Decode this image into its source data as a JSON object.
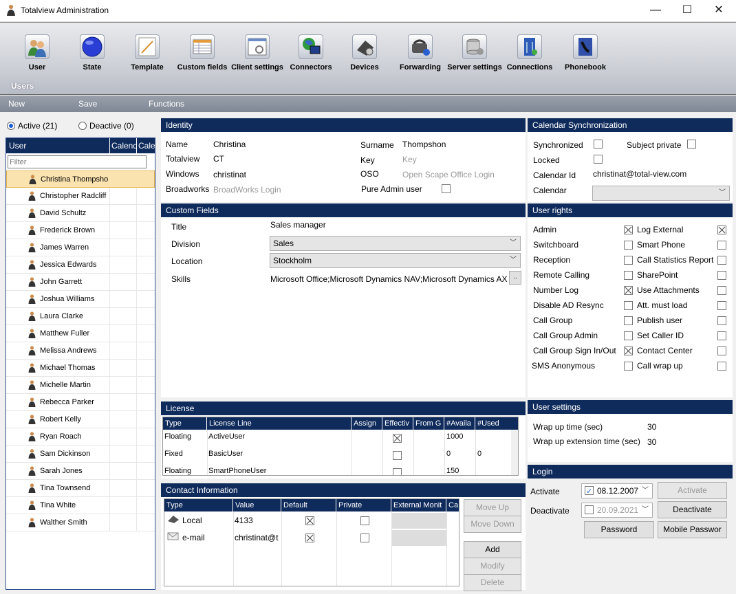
{
  "window": {
    "title": "Totalview  Administration",
    "min": "—",
    "max": "☐",
    "close": "✕"
  },
  "ribbon": {
    "items": [
      "User",
      "State",
      "Template",
      "Custom fields",
      "Client settings",
      "Connectors",
      "Devices",
      "Forwarding",
      "Server settings",
      "Connections",
      "Phonebook"
    ],
    "group": "Users"
  },
  "tabs": {
    "new": "New",
    "save": "Save",
    "functions": "Functions"
  },
  "left": {
    "active": "Active (21)",
    "deactive": "Deactive (0)",
    "col_user": "User",
    "col_cal1": "Calend",
    "col_cal2": "Cale",
    "filter_placeholder": "Filter",
    "users": [
      "Christina Thompsho",
      "Christopher Radcliff",
      "David Schultz",
      "Frederick Brown",
      "James Warren",
      "Jessica Edwards",
      "John Garrett",
      "Joshua Williams",
      "Laura Clarke",
      "Matthew Fuller",
      "Melissa Andrews",
      "Michael Thomas",
      "Michelle Martin",
      "Rebecca Parker",
      "Robert Kelly",
      "Ryan Roach",
      "Sam Dickinson",
      "Sarah Jones",
      "Tina Townsend",
      "Tina White",
      "Walther Smith"
    ]
  },
  "identity": {
    "header": "Identity",
    "name_l": "Name",
    "name_v": "Christina",
    "totalview_l": "Totalview",
    "totalview_v": "CT",
    "windows_l": "Windows",
    "windows_v": "christinat",
    "broadworks_l": "Broadworks",
    "broadworks_ph": "BroadWorks Login",
    "surname_l": "Surname",
    "surname_v": "Thompshon",
    "key_l": "Key",
    "key_ph": "Key",
    "oso_l": "OSO",
    "oso_ph": "Open Scape Office Login",
    "pure_l": "Pure Admin user"
  },
  "custom": {
    "header": "Custom Fields",
    "title_l": "Title",
    "title_v": "Sales manager",
    "division_l": "Division",
    "division_v": "Sales",
    "location_l": "Location",
    "location_v": "Stockholm",
    "skills_l": "Skills",
    "skills_v": "Microsoft Office;Microsoft Dynamics NAV;Microsoft Dynamics AX",
    "skills_btn": ".."
  },
  "license": {
    "header": "License",
    "cols": [
      "Type",
      "License Line",
      "Assign",
      "Effectiv",
      "From G",
      "#Availa",
      "#Used"
    ],
    "rows": [
      {
        "type": "Floating",
        "line": "ActiveUser",
        "avail": "1000",
        "used": ""
      },
      {
        "type": "Fixed",
        "line": "BasicUser",
        "avail": "0",
        "used": "0"
      },
      {
        "type": "Floating",
        "line": "SmartPhoneUser",
        "avail": "150",
        "used": ""
      }
    ]
  },
  "contact": {
    "header": "Contact Information",
    "cols": [
      "Type",
      "Value",
      "Default",
      "Private",
      "External Monit",
      "Ca"
    ],
    "rows": [
      {
        "type": "Local",
        "value": "4133"
      },
      {
        "type": "e-mail",
        "value": "christinat@t"
      }
    ],
    "move_up": "Move Up",
    "move_down": "Move Down",
    "add": "Add",
    "modify": "Modify",
    "delete": "Delete"
  },
  "calendar": {
    "header": "Calendar Synchronization",
    "sync_l": "Synchronized",
    "subject_l": "Subject private",
    "locked_l": "Locked",
    "calid_l": "Calendar Id",
    "calid_v": "christinat@total-view.com",
    "calendar_l": "Calendar"
  },
  "rights": {
    "header": "User rights",
    "left": [
      "Admin",
      "Switchboard",
      "Reception",
      "Remote Calling",
      "Number Log",
      "Disable AD Resync",
      "Call Group",
      "Call Group Admin",
      "Call Group Sign In/Out",
      "SMS Anonymous"
    ],
    "right": [
      "Log External",
      "Smart Phone",
      "Call Statistics Report",
      "SharePoint",
      "Use Attachments",
      "Att. must load",
      "Publish user",
      "Set Caller ID",
      "Contact Center",
      "Call wrap up"
    ]
  },
  "settings": {
    "header": "User settings",
    "wrap_l": "Wrap up time (sec)",
    "wrap_v": "30",
    "wrapext_l": "Wrap up extension time (sec)",
    "wrapext_v": "30"
  },
  "login": {
    "header": "Login",
    "activate_l": "Activate",
    "activate_v": "08.12.2007",
    "deactivate_l": "Deactivate",
    "deactivate_v": "20.09.2021",
    "activate_btn": "Activate",
    "deactivate_btn": "Deactivate",
    "password_btn": "Password",
    "mobile_btn": "Mobile Passwor"
  }
}
